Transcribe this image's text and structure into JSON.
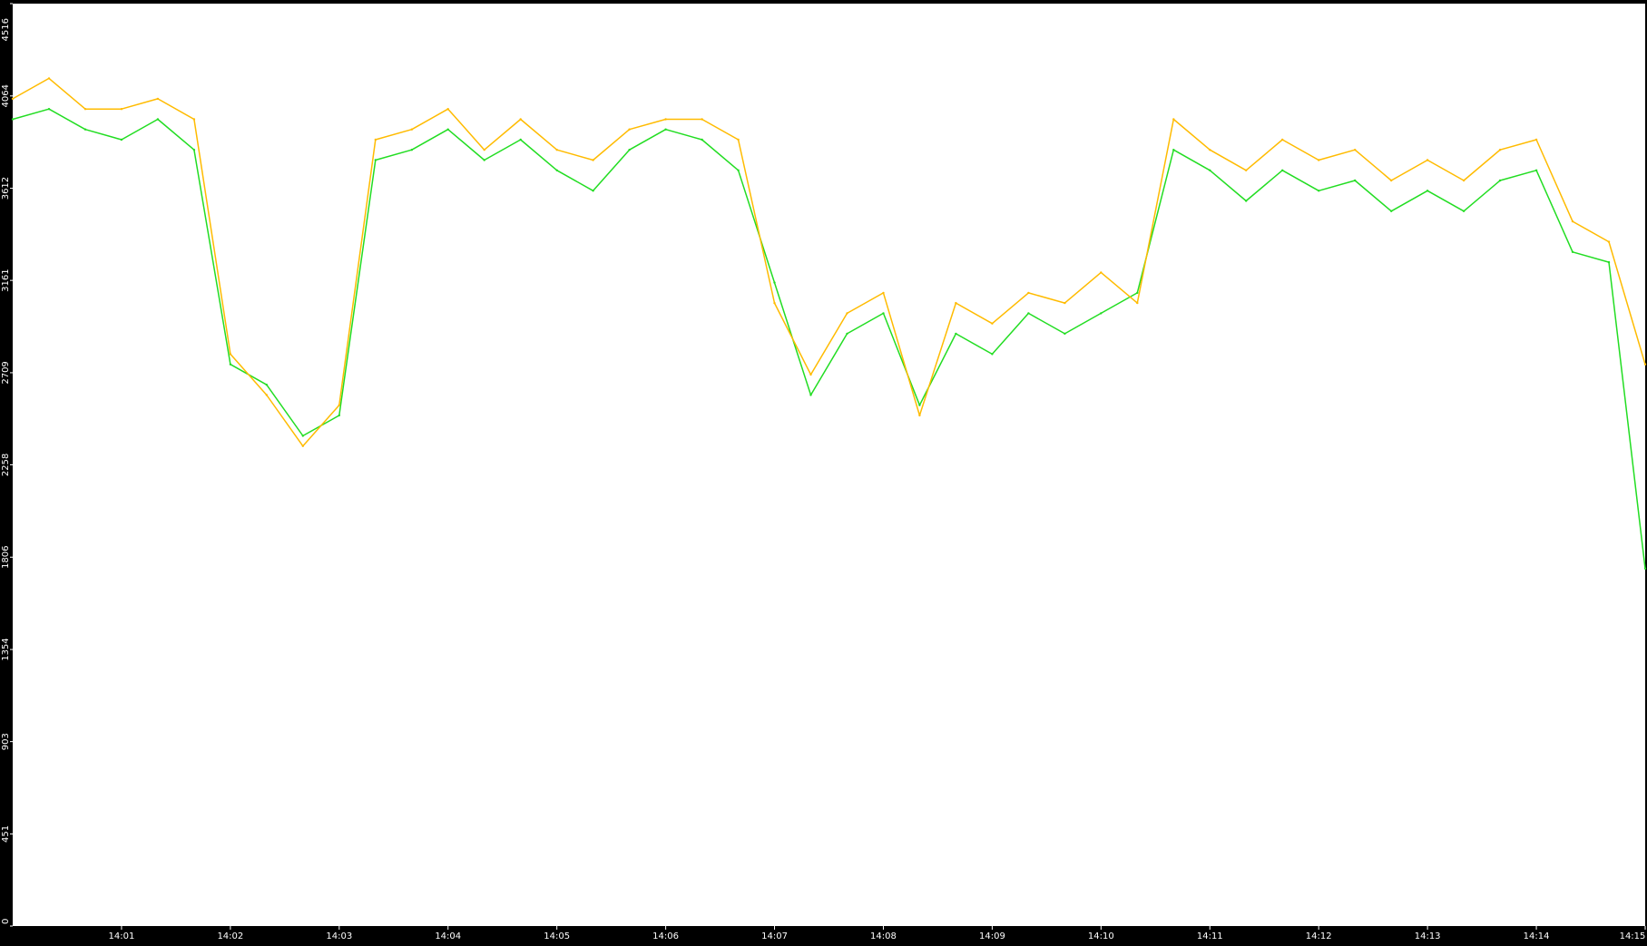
{
  "chart_data": {
    "type": "line",
    "title": "",
    "xlabel": "",
    "ylabel": "",
    "ylim": [
      0,
      4516
    ],
    "y_ticks": [
      0,
      451,
      903,
      1354,
      1806,
      2258,
      2709,
      3161,
      3612,
      4064,
      4516
    ],
    "xlim": [
      "14:00:00",
      "14:15:00"
    ],
    "x_ticks": [
      "14:01",
      "14:02",
      "14:03",
      "14:04",
      "14:05",
      "14:06",
      "14:07",
      "14:08",
      "14:09",
      "14:10",
      "14:11",
      "14:12",
      "14:13",
      "14:14",
      "14:15"
    ],
    "grid": false,
    "legend": "none",
    "colors": {
      "background": "#000000",
      "plot_area": "#ffffff",
      "axis_text": "#ffffff",
      "series_a": "#22dd22",
      "series_b": "#ffbb00"
    },
    "series": [
      {
        "color": "#22dd22",
        "x": [
          "14:00:00",
          "14:00:20",
          "14:00:40",
          "14:01:00",
          "14:01:20",
          "14:01:40",
          "14:02:00",
          "14:02:20",
          "14:02:40",
          "14:03:00",
          "14:03:20",
          "14:03:40",
          "14:04:00",
          "14:04:20",
          "14:04:40",
          "14:05:00",
          "14:05:20",
          "14:05:40",
          "14:06:00",
          "14:06:20",
          "14:06:40",
          "14:07:00",
          "14:07:20",
          "14:07:40",
          "14:08:00",
          "14:08:20",
          "14:08:40",
          "14:09:00",
          "14:09:20",
          "14:09:40",
          "14:10:00",
          "14:10:20",
          "14:10:40",
          "14:11:00",
          "14:11:20",
          "14:11:40",
          "14:12:00",
          "14:12:20",
          "14:12:40",
          "14:13:00",
          "14:13:20",
          "14:13:40",
          "14:14:00",
          "14:14:20",
          "14:14:40",
          "14:15:00"
        ],
        "values": [
          3950,
          4000,
          3900,
          3850,
          3950,
          3800,
          2750,
          2650,
          2400,
          2500,
          3750,
          3800,
          3900,
          3750,
          3850,
          3700,
          3600,
          3800,
          3900,
          3850,
          3700,
          3150,
          2600,
          2900,
          3000,
          2550,
          2900,
          2800,
          3000,
          2900,
          3000,
          3100,
          3800,
          3700,
          3550,
          3700,
          3600,
          3650,
          3500,
          3600,
          3500,
          3650,
          3700,
          3300,
          3250,
          1750
        ]
      },
      {
        "color": "#ffbb00",
        "x": [
          "14:00:00",
          "14:00:20",
          "14:00:40",
          "14:01:00",
          "14:01:20",
          "14:01:40",
          "14:02:00",
          "14:02:20",
          "14:02:40",
          "14:03:00",
          "14:03:20",
          "14:03:40",
          "14:04:00",
          "14:04:20",
          "14:04:40",
          "14:05:00",
          "14:05:20",
          "14:05:40",
          "14:06:00",
          "14:06:20",
          "14:06:40",
          "14:07:00",
          "14:07:20",
          "14:07:40",
          "14:08:00",
          "14:08:20",
          "14:08:40",
          "14:09:00",
          "14:09:20",
          "14:09:40",
          "14:10:00",
          "14:10:20",
          "14:10:40",
          "14:11:00",
          "14:11:20",
          "14:11:40",
          "14:12:00",
          "14:12:20",
          "14:12:40",
          "14:13:00",
          "14:13:20",
          "14:13:40",
          "14:14:00",
          "14:14:20",
          "14:14:40",
          "14:15:00"
        ],
        "values": [
          4050,
          4150,
          4000,
          4000,
          4050,
          3950,
          2800,
          2600,
          2350,
          2550,
          3850,
          3900,
          4000,
          3800,
          3950,
          3800,
          3750,
          3900,
          3950,
          3950,
          3850,
          3050,
          2700,
          3000,
          3100,
          2500,
          3050,
          2950,
          3100,
          3050,
          3200,
          3050,
          3950,
          3800,
          3700,
          3850,
          3750,
          3800,
          3650,
          3750,
          3650,
          3800,
          3850,
          3450,
          3350,
          2750
        ]
      }
    ]
  }
}
